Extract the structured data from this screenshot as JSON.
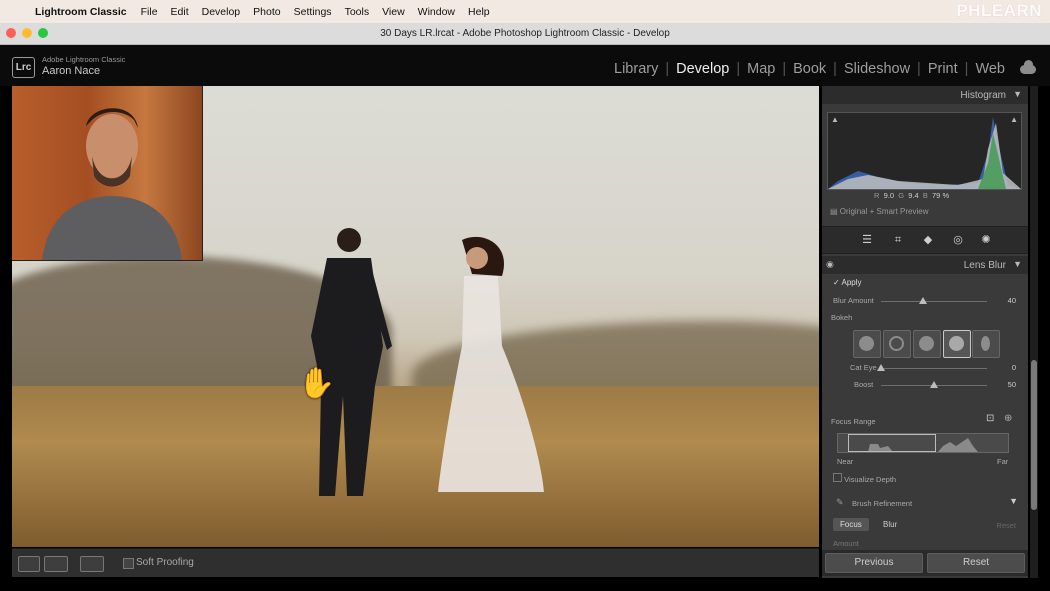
{
  "mac_menu": {
    "app_name": "Lightroom Classic",
    "items": [
      "File",
      "Edit",
      "Develop",
      "Photo",
      "Settings",
      "Tools",
      "View",
      "Window",
      "Help"
    ]
  },
  "watermark": "PHLEARN",
  "window": {
    "title": "30 Days LR.lrcat - Adobe Photoshop Lightroom Classic - Develop"
  },
  "identity": {
    "logo": "Lrc",
    "product": "Adobe Lightroom Classic",
    "user": "Aaron Nace"
  },
  "modules": [
    "Library",
    "Develop",
    "Map",
    "Book",
    "Slideshow",
    "Print",
    "Web"
  ],
  "active_module": "Develop",
  "histogram": {
    "title": "Histogram",
    "readout": {
      "r_label": "R",
      "r": "9.0",
      "g_label": "G",
      "g": "9.4",
      "b_label": "B",
      "b": "79 %"
    },
    "preview": "Original + Smart Preview"
  },
  "lens_blur": {
    "title": "Lens Blur",
    "apply": "Apply",
    "blur_amount_label": "Blur Amount",
    "blur_amount": "40",
    "bokeh_label": "Bokeh",
    "cat_eye_label": "Cat Eye",
    "cat_eye": "0",
    "boost_label": "Boost",
    "boost": "50",
    "focus_range_label": "Focus Range",
    "near": "Near",
    "far": "Far",
    "visualize_depth": "Visualize Depth",
    "brush_refinement": "Brush Refinement",
    "focus_btn": "Focus",
    "blur_btn": "Blur",
    "reset_small": "Reset",
    "amount_label": "Amount"
  },
  "toolbar": {
    "soft_proofing": "Soft Proofing"
  },
  "bottom_buttons": {
    "previous": "Previous",
    "reset": "Reset"
  },
  "colors": {
    "active_module": "#efefef",
    "panel_bg": "#3a3a3a",
    "accent": "#c9c9c9"
  },
  "slider_values": {
    "blur_amount_fraction": 0.4,
    "cat_eye_fraction": 0.0,
    "boost_fraction": 0.5
  }
}
